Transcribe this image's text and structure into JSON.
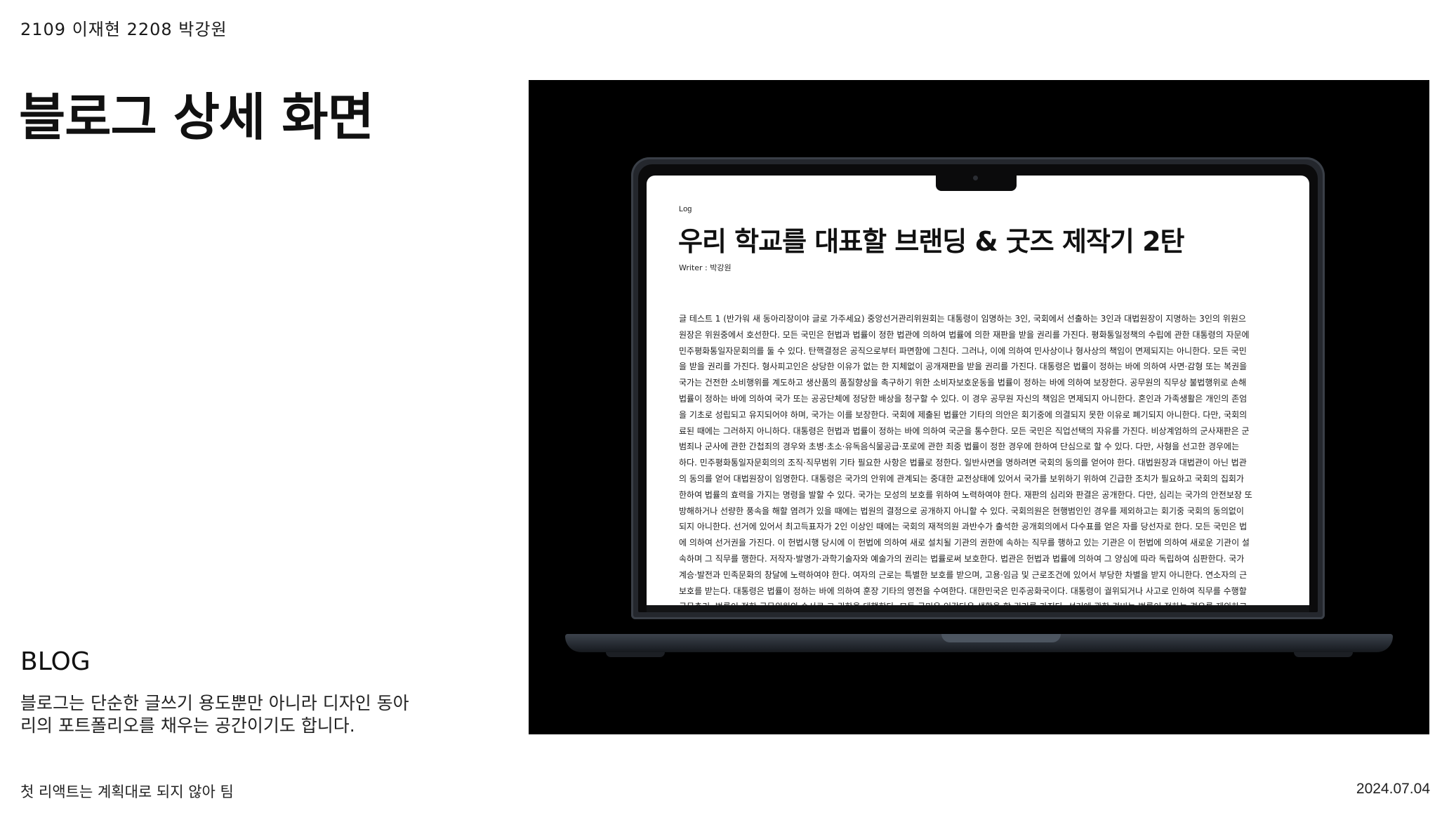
{
  "header": {
    "authors": "2109 이재현 2208 박강원",
    "title": "블로그 상세 화면"
  },
  "section": {
    "heading": "BLOG",
    "description": "블로그는 단순한 글쓰기 용도뿐만 아니라 디자인 동아리의 포트폴리오를 채우는 공간이기도 합니다."
  },
  "footer": {
    "team": "첫 리액트는 계획대로 되지 않아 팀",
    "date": "2024.07.04"
  },
  "colors": {
    "panel_bg": "#000000",
    "laptop_frame": "#24272d",
    "screen_bg": "#ffffff"
  },
  "screen": {
    "category": "Log",
    "post_title": "우리 학교를 대표할 브랜딩 & 굿즈 제작기 2탄",
    "writer": "Writer : 박강원",
    "body_lines": [
      "글 테스트 1 (반가워 새 동아리장이야 글로 가주세요) 중앙선거관리위원회는 대통령이 임명하는 3인, 국회에서 선출하는 3인과 대법원장이 지명하는 3인의 위원으",
      "원장은 위원중에서 호선한다. 모든 국민은 헌법과 법률이 정한 법관에 의하여 법률에 의한 재판을 받을 권리를 가진다. 평화통일정책의 수립에 관한 대통령의 자문에",
      "민주평화통일자문회의를 둘 수 있다. 탄핵결정은 공직으로부터 파면함에 그친다. 그러나, 이에 의하여 민사상이나 형사상의 책임이 면제되지는 아니한다. 모든 국민",
      "을 받을 권리를 가진다. 형사피고인은 상당한 이유가 없는 한 지체없이 공개재판을 받을 권리를 가진다. 대통령은 법률이 정하는 바에 의하여 사면·감형 또는 복권을",
      "국가는 건전한 소비행위를 계도하고 생산품의 품질향상을 촉구하기 위한 소비자보호운동을 법률이 정하는 바에 의하여 보장한다. 공무원의 직무상 불법행위로 손해",
      "법률이 정하는 바에 의하여 국가 또는 공공단체에 정당한 배상을 청구할 수 있다. 이 경우 공무원 자신의 책임은 면제되지 아니한다. 혼인과 가족생활은 개인의 존엄",
      "을 기초로 성립되고 유지되어야 하며, 국가는 이를 보장한다. 국회에 제출된 법률안 기타의 의안은 회기중에 의결되지 못한 이유로 폐기되지 아니한다. 다만, 국회의",
      "료된 때에는 그러하지 아니하다. 대통령은 헌법과 법률이 정하는 바에 의하여 국군을 통수한다. 모든 국민은 직업선택의 자유를 가진다. 비상계엄하의 군사재판은 군",
      "범죄나 군사에 관한 간첩죄의 경우와 초병·초소·유독음식물공급·포로에 관한 죄중 법률이 정한 경우에 한하여 단심으로 할 수 있다. 다만, 사형을 선고한 경우에는",
      "하다. 민주평화통일자문회의의 조직·직무범위 기타 필요한 사항은 법률로 정한다. 일반사면을 명하려면 국회의 동의를 얻어야 한다. 대법원장과 대법관이 아닌 법관",
      "의 동의를 얻어 대법원장이 임명한다. 대통령은 국가의 안위에 관계되는 중대한 교전상태에 있어서 국가를 보위하기 위하여 긴급한 조치가 필요하고 국회의 집회가",
      "한하여 법률의 효력을 가지는 명령을 발할 수 있다. 국가는 모성의 보호를 위하여 노력하여야 한다. 재판의 심리와 판결은 공개한다. 다만, 심리는 국가의 안전보장 또",
      "방해하거나 선량한 풍속을 해할 염려가 있을 때에는 법원의 결정으로 공개하지 아니할 수 있다. 국회의원은 현행범인인 경우를 제외하고는 회기중 국회의 동의없이",
      "되지 아니한다. 선거에 있어서 최고득표자가 2인 이상인 때에는 국회의 재적의원 과반수가 출석한 공개회의에서 다수표를 얻은 자를 당선자로 한다. 모든 국민은 법",
      "에 의하여 선거권을 가진다. 이 헌법시행 당시에 이 헌법에 의하여 새로 설치될 기관의 권한에 속하는 직무를 행하고 있는 기관은 이 헌법에 의하여 새로운 기관이 설",
      "속하며 그 직무를 행한다. 저작자·발명가·과학기술자와 예술가의 권리는 법률로써 보호한다. 법관은 헌법과 법률에 의하여 그 양심에 따라 독립하여 심판한다. 국가",
      "계승·발전과 민족문화의 창달에 노력하여야 한다. 여자의 근로는 특별한 보호를 받으며, 고용·임금 및 근로조건에 있어서 부당한 차별을 받지 아니한다. 연소자의 근",
      "보호를 받는다. 대통령은 법률이 정하는 바에 의하여 훈장 기타의 영전을 수여한다. 대한민국은 민주공화국이다. 대통령이 궐위되거나 사고로 인하여 직무를 수행할",
      "국무총리, 법률이 정한 국무위원의 순서로 그 권한을 대행한다. 모든 국민은 인간다운 생활을 할 권리를 가진다. 선거에 관한 경비는 법률이 정하는 경우를 제외하고"
    ]
  }
}
